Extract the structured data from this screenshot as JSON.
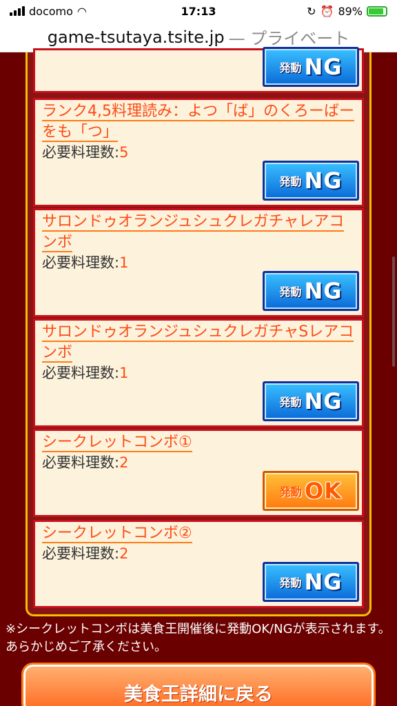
{
  "status_bar": {
    "carrier": "docomo",
    "time": "17:13",
    "battery": "89%"
  },
  "url_bar": {
    "domain": "game-tsutaya.tsite.jp",
    "suffix": "— プライベート"
  },
  "cards": [
    {
      "title": "",
      "requirement": "",
      "count": "",
      "status": "NG"
    },
    {
      "title": "ランク4,5料理読み：よつ「ば」のくろーばーをも「つ」",
      "requirement": "必要料理数:",
      "count": "5",
      "status": "NG"
    },
    {
      "title": "サロンドゥオランジュシュクレガチャレアコンボ",
      "requirement": "必要料理数:",
      "count": "1",
      "status": "NG"
    },
    {
      "title": "サロンドゥオランジュシュクレガチャSレアコンボ",
      "requirement": "必要料理数:",
      "count": "1",
      "status": "NG"
    },
    {
      "title": "シークレットコンボ①",
      "requirement": "必要料理数:",
      "count": "2",
      "status": "OK"
    },
    {
      "title": "シークレットコンボ②",
      "requirement": "必要料理数:",
      "count": "2",
      "status": "NG"
    }
  ],
  "button_labels": {
    "prefix": "発動",
    "ng": "NG",
    "ok": "OK"
  },
  "note": "※シークレットコンボは美食王開催後に発動OK/NGが表示されます。あらかじめご了承ください。",
  "back_button": "美食王詳細に戻る",
  "colors": {
    "background": "#6b0000",
    "card": "#fdf3dc",
    "card_border": "#c80f1a",
    "frame_border": "#f2c200",
    "title_orange": "#ff4a14",
    "ng_blue": "#0a6ad8",
    "ok_orange": "#ff7a10"
  }
}
